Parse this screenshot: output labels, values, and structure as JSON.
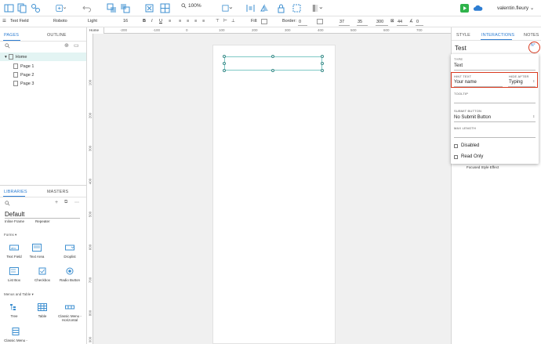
{
  "toolbar": {
    "zoom": "100%",
    "user": "valentin.fleury"
  },
  "format": {
    "widget": "Text Field",
    "font": "Roboto",
    "weight": "Light",
    "size": "16",
    "fill": "Fill:",
    "border_label": "Border:",
    "border_value": "0",
    "x": "37",
    "y": "35",
    "w": "300",
    "h": "44",
    "angle": "0"
  },
  "left": {
    "tabs": [
      "PAGES",
      "OUTLINE"
    ],
    "pages": [
      "Home",
      "Page 1",
      "Page 2",
      "Page 3"
    ],
    "lib_tabs": [
      "LIBRARIES",
      "MASTERS"
    ],
    "library": "Default",
    "inline": [
      "Inline Frame",
      "Repeater"
    ],
    "section_forms": "Forms ▾",
    "forms": [
      "Text Field",
      "Text Area",
      "Droplist",
      "List Box",
      "Checkbox",
      "Radio Button"
    ],
    "section_menus": "Menus and Table ▾",
    "menus": [
      "Tree",
      "Table",
      "Classic Menu - Horizontal",
      "Classic Menu -"
    ]
  },
  "canvas": {
    "tab": "Home",
    "ruler_top": [
      "-200",
      "-100",
      "0",
      "100",
      "200",
      "300",
      "400",
      "500",
      "600",
      "700"
    ],
    "ruler_left": [
      "100",
      "200",
      "300",
      "400",
      "500",
      "600",
      "700",
      "800",
      "900"
    ]
  },
  "right": {
    "tabs": [
      "STYLE",
      "INTERACTIONS",
      "NOTES"
    ],
    "name": "Test",
    "type_label": "TYPE",
    "type_value": "Text",
    "hint_label": "HINT TEXT",
    "hint_value": "Your name",
    "hide_label": "HIDE AFTER",
    "hide_value": "Typing",
    "tooltip_label": "TOOLTIP",
    "submit_label": "SUBMIT BUTTON",
    "submit_value": "No Submit Button",
    "maxlen_label": "MAX LENGTH",
    "disabled": "Disabled",
    "readonly": "Read Only",
    "focused": "Focused Style Effect",
    "highlight_color": "#d9391f",
    "accent": "#2d7dd2"
  }
}
